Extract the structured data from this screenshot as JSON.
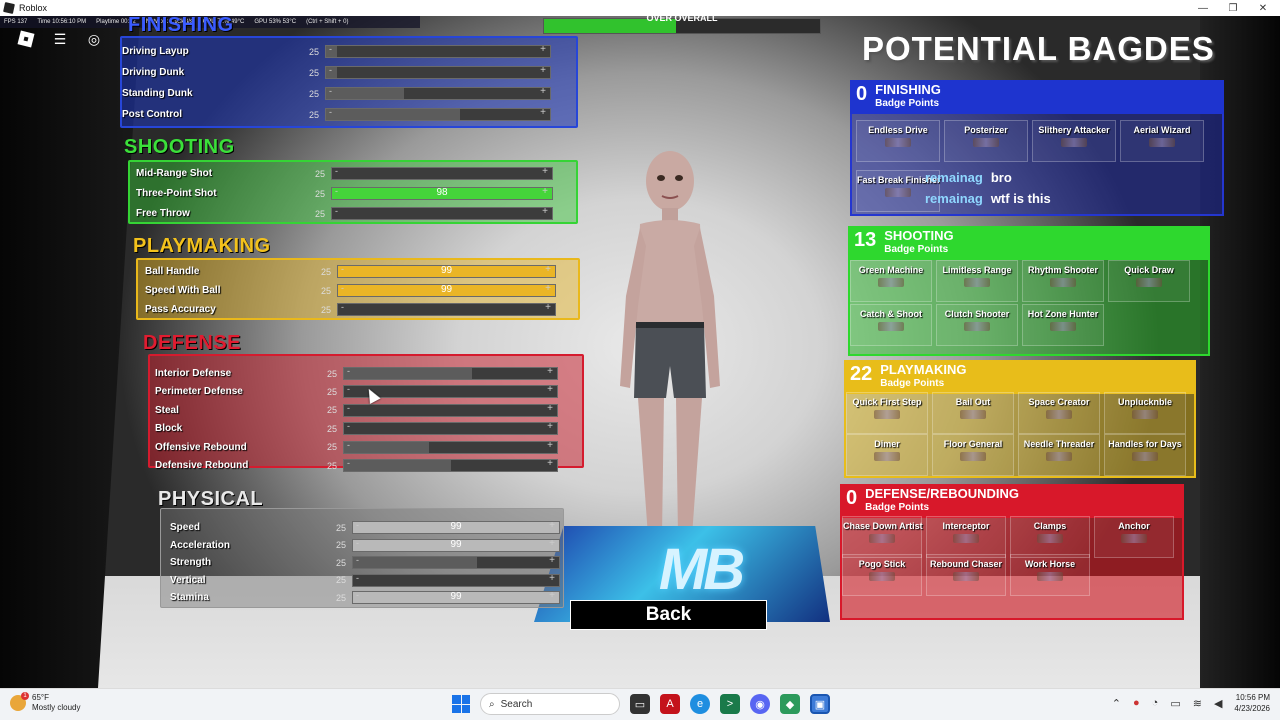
{
  "window": {
    "title": "Roblox",
    "minimize": "—",
    "maximize": "❐",
    "close": "✕"
  },
  "hud": {
    "fps": "FPS 137",
    "time": "Time 10:56:10 PM",
    "playtime": "Playtime 00:22",
    "network": "Network 1.98kB/s",
    "cpu": "CPU 72% 49°C",
    "gpu": "GPU 53% 53°C",
    "shortcut": "(Ctrl + Shift + 0)"
  },
  "top_progress": {
    "label": "OVER OVERALL",
    "fraction": 0.48
  },
  "attributes": {
    "finishing": {
      "title": "FINISHING",
      "rows": [
        {
          "name": "Driving Layup",
          "base": "25",
          "fraction": 0.05,
          "value": ""
        },
        {
          "name": "Driving Dunk",
          "base": "25",
          "fraction": 0.05,
          "value": ""
        },
        {
          "name": "Standing Dunk",
          "base": "25",
          "fraction": 0.35,
          "value": ""
        },
        {
          "name": "Post Control",
          "base": "25",
          "fraction": 0.6,
          "value": ""
        }
      ]
    },
    "shooting": {
      "title": "SHOOTING",
      "rows": [
        {
          "name": "Mid-Range Shot",
          "base": "25",
          "fraction": 0.0,
          "value": ""
        },
        {
          "name": "Three-Point Shot",
          "base": "25",
          "fraction": 1.0,
          "value": "98"
        },
        {
          "name": "Free Throw",
          "base": "25",
          "fraction": 0.0,
          "value": ""
        }
      ]
    },
    "playmaking": {
      "title": "PLAYMAKING",
      "rows": [
        {
          "name": "Ball Handle",
          "base": "25",
          "fraction": 1.0,
          "value": "99"
        },
        {
          "name": "Speed With Ball",
          "base": "25",
          "fraction": 1.0,
          "value": "99"
        },
        {
          "name": "Pass Accuracy",
          "base": "25",
          "fraction": 0.0,
          "value": ""
        }
      ]
    },
    "defense": {
      "title": "DEFENSE",
      "rows": [
        {
          "name": "Interior Defense",
          "base": "25",
          "fraction": 0.6,
          "value": ""
        },
        {
          "name": "Perimeter Defense",
          "base": "25",
          "fraction": 0.0,
          "value": ""
        },
        {
          "name": "Steal",
          "base": "25",
          "fraction": 0.0,
          "value": ""
        },
        {
          "name": "Block",
          "base": "25",
          "fraction": 0.0,
          "value": ""
        },
        {
          "name": "Offensive Rebound",
          "base": "25",
          "fraction": 0.4,
          "value": ""
        },
        {
          "name": "Defensive Rebound",
          "base": "25",
          "fraction": 0.5,
          "value": ""
        }
      ]
    },
    "physical": {
      "title": "PHYSICAL",
      "rows": [
        {
          "name": "Speed",
          "base": "25",
          "fraction": 1.0,
          "value": "99"
        },
        {
          "name": "Acceleration",
          "base": "25",
          "fraction": 1.0,
          "value": "99"
        },
        {
          "name": "Strength",
          "base": "25",
          "fraction": 0.6,
          "value": ""
        },
        {
          "name": "Vertical",
          "base": "25",
          "fraction": 0.0,
          "value": ""
        },
        {
          "name": "Stamina",
          "base": "25",
          "fraction": 1.0,
          "value": "99"
        }
      ]
    }
  },
  "badges": {
    "heading": "POTENTIAL BAGDES",
    "points_label": "Badge Points",
    "finishing": {
      "title": "FINISHING",
      "points": "0",
      "items": [
        "Endless Drive",
        "Posterizer",
        "Slithery Attacker",
        "Aerial Wizard",
        "Fast Break Finisher"
      ]
    },
    "shooting": {
      "title": "SHOOTING",
      "points": "13",
      "items": [
        "Green Machine",
        "Limitless Range",
        "Rhythm Shooter",
        "Quick Draw",
        "Catch & Shoot",
        "Clutch Shooter",
        "Hot Zone Hunter"
      ]
    },
    "playmaking": {
      "title": "PLAYMAKING",
      "points": "22",
      "items": [
        "Quick First Step",
        "Bail Out",
        "Space Creator",
        "Unplucknble",
        "Dimer",
        "Floor General",
        "Needle Threader",
        "Handles for Days"
      ]
    },
    "defense": {
      "title": "DEFENSE/REBOUNDING",
      "points": "0",
      "items": [
        "Chase Down Artist",
        "Interceptor",
        "Clamps",
        "Anchor",
        "Pogo Stick",
        "Rebound Chaser",
        "Work Horse"
      ]
    }
  },
  "chat": [
    {
      "user": "remainag",
      "message": "bro"
    },
    {
      "user": "remainag",
      "message": "wtf is this"
    }
  ],
  "platform_logo": "MB",
  "back_label": "Back",
  "taskbar": {
    "temperature": "65°F",
    "condition": "Mostly cloudy",
    "search_placeholder": "Search",
    "time": "10:56 PM",
    "date": "4/23/2026",
    "notification_count": "1"
  },
  "colors": {
    "finishing": "#1a3bb8",
    "shooting": "#2ec22a",
    "playmaking": "#e3b51a",
    "defense": "#c8182a",
    "physical": "#9a9a9a"
  }
}
